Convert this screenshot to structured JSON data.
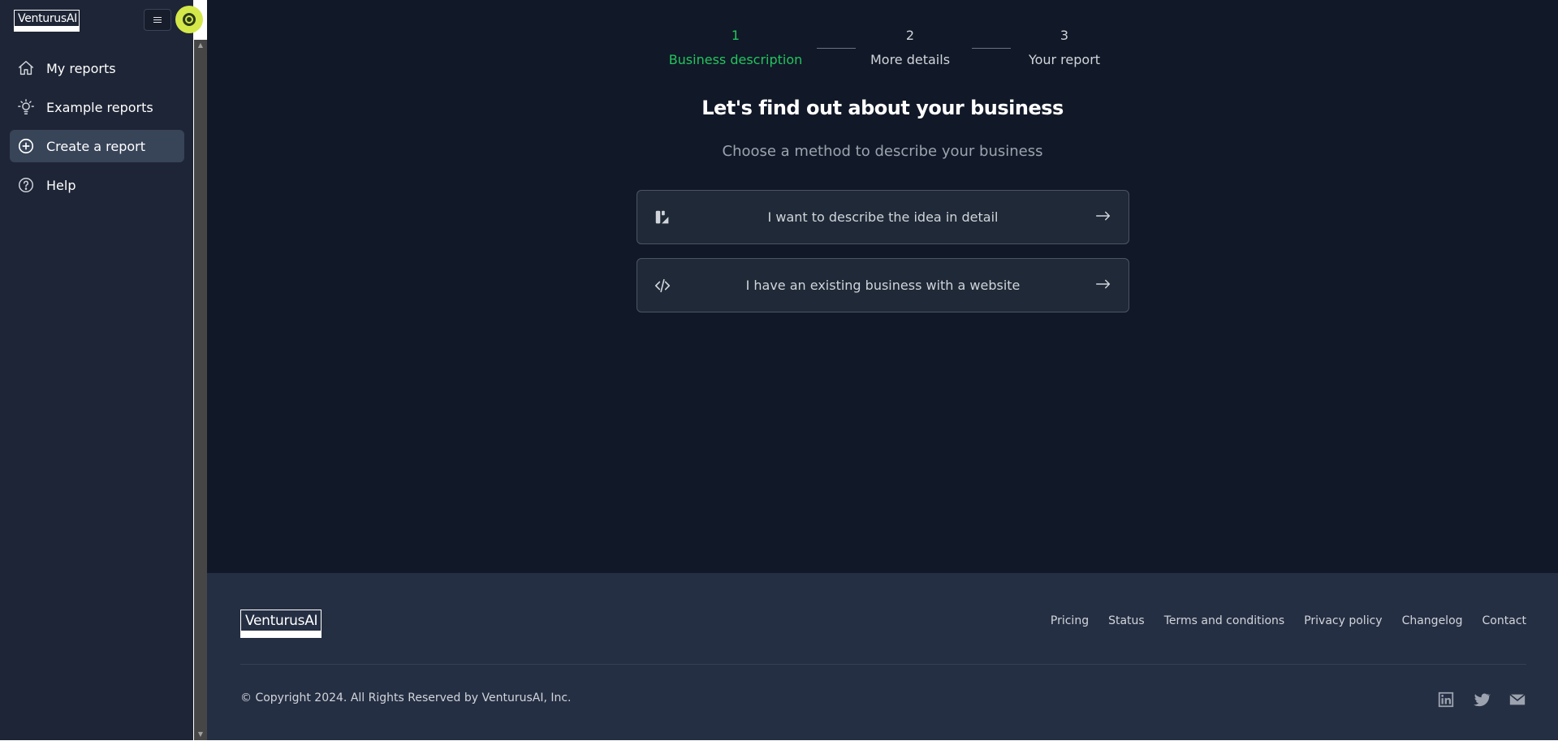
{
  "brand": {
    "name": "VenturusAI"
  },
  "sidebar": {
    "items": [
      {
        "label": "My reports",
        "icon": "home-icon",
        "active": false
      },
      {
        "label": "Example reports",
        "icon": "lightbulb-icon",
        "active": false
      },
      {
        "label": "Create a report",
        "icon": "plus-circle-icon",
        "active": true
      },
      {
        "label": "Help",
        "icon": "help-circle-icon",
        "active": false
      }
    ]
  },
  "steps": [
    {
      "number": "1",
      "label": "Business description",
      "active": true
    },
    {
      "number": "2",
      "label": "More details",
      "active": false
    },
    {
      "number": "3",
      "label": "Your report",
      "active": false
    }
  ],
  "main": {
    "heading": "Let's find out about your business",
    "subheading": "Choose a method to describe your business",
    "options": [
      {
        "label": "I want to describe the idea in detail",
        "icon": "edit-shapes-icon"
      },
      {
        "label": "I have an existing business with a website",
        "icon": "code-icon"
      }
    ]
  },
  "footer": {
    "links": [
      "Pricing",
      "Status",
      "Terms and conditions",
      "Privacy policy",
      "Changelog",
      "Contact"
    ],
    "copyright": "© Copyright 2024. All Rights Reserved by VenturusAI, Inc.",
    "social": [
      "linkedin-icon",
      "twitter-icon",
      "mail-icon"
    ]
  },
  "colors": {
    "accent": "#22c55e",
    "sidebar_bg": "#1e2536",
    "main_bg": "#111827",
    "footer_bg": "#252f43"
  }
}
